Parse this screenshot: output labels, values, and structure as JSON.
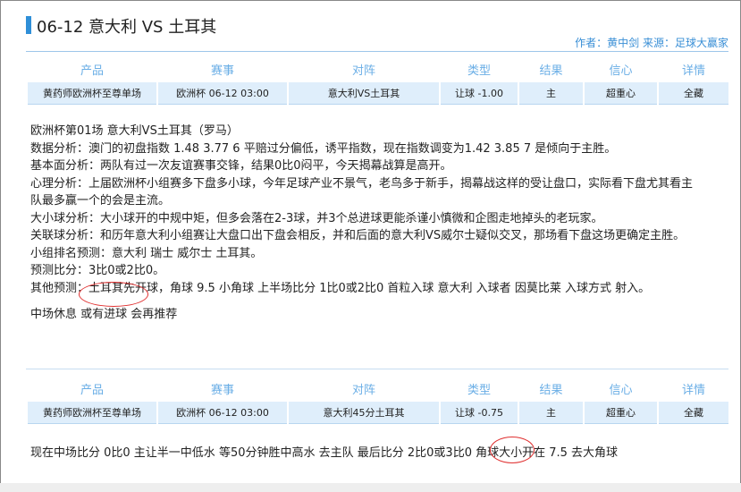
{
  "page": {
    "title": "06-12 意大利 VS 土耳其",
    "author_label": "作者：",
    "author": "黄中剑",
    "source_label": "来源：",
    "source": "足球大赢家"
  },
  "table_headers": [
    "产品",
    "赛事",
    "对阵",
    "类型",
    "结果",
    "信心",
    "详情"
  ],
  "table1_row": [
    "黄药师欧洲杯至尊单场",
    "欧洲杯 06-12 03:00",
    "意大利VS土耳其",
    "让球 -1.00",
    "主",
    "超重心",
    "全藏"
  ],
  "article": {
    "line1": "欧洲杯第01场 意大利VS土耳其（罗马）",
    "line2": "数据分析：澳门的初盘指数 1.48 3.77 6 平赔过分偏低，诱平指数，现在指数调变为1.42 3.85 7 是倾向于主胜。",
    "line3": "基本面分析：两队有过一次友谊赛事交锋，结果0比0闷平，今天揭幕战算是高开。",
    "line4": "心理分析：上届欧洲杯小组赛多下盘多小球，今年足球产业不景气，老鸟多于新手，揭幕战这样的受让盘口，实际看下盘尤其看主队最多赢一个的会是主流。",
    "line5": "大小球分析：大小球开的中规中矩，但多会落在2-3球，并3个总进球更能杀谨小慎微和企图走地掉头的老玩家。",
    "line6": "关联球分析：和历年意大利小组赛让大盘口出下盘会相反，并和后面的意大利VS威尔士疑似交叉，那场看下盘这场更确定主胜。",
    "line7": "小组排名预测：意大利 瑞士 威尔士 土耳其。",
    "line8": "预测比分：3比0或2比0。",
    "line9": "其他预测：土耳其先开球，角球 9.5 小角球 上半场比分 1比0或2比0 首粒入球 意大利 入球者 因莫比莱 入球方式 射入。",
    "line10": "中场休息  或有进球  会再推荐"
  },
  "table2_row": [
    "黄药师欧洲杯至尊单场",
    "欧洲杯 06-12 03:00",
    "意大利45分土耳其",
    "让球 -0.75",
    "主",
    "超重心",
    "全藏"
  ],
  "bottom_text": "现在中场比分  0比0  主让半一中低水  等50分钟胜中高水  去主队  最后比分  2比0或3比0  角球大小开在  7.5  去大角球",
  "colors": {
    "accent": "#2f8fd8",
    "header_text": "#6aaee6",
    "row_bg": "#dfeefb",
    "annotation": "#e03030"
  }
}
